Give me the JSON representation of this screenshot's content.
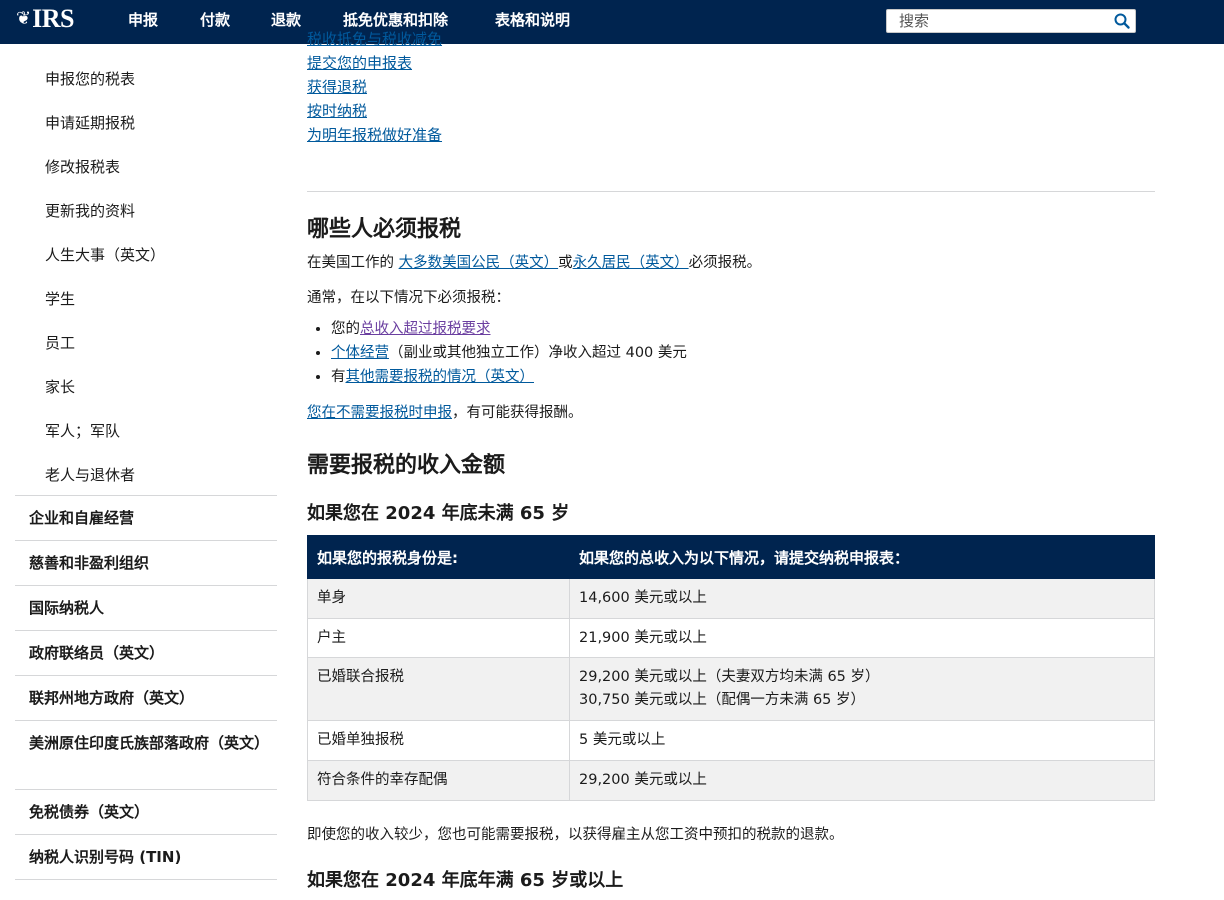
{
  "header": {
    "logo_text": "IRS",
    "nav": [
      "申报",
      "付款",
      "退款",
      "抵免优惠和扣除",
      "表格和说明"
    ],
    "search_placeholder": "搜索"
  },
  "sidebar": {
    "sub_items": [
      "申报您的税表",
      "申请延期报税",
      "修改报税表",
      "更新我的资料",
      "人生大事（英文）",
      "学生",
      "员工",
      "家长",
      "军人；军队",
      "老人与退休者"
    ],
    "main_items": [
      "企业和自雇经营",
      "慈善和非盈利组织",
      "国际纳税人",
      "政府联络员（英文）",
      "联邦州地方政府（英文）",
      "美洲原住印度氏族部落政府（英文）",
      "免税债券（英文）",
      "纳税人识别号码 (TIN)"
    ]
  },
  "main": {
    "top_links": [
      "税收抵免与税收减免",
      "提交您的申报表",
      "获得退税",
      "按时纳税",
      "为明年报税做好准备"
    ],
    "who_must_file": {
      "heading": "哪些人必须报税",
      "intro_prefix": "在美国工作的 ",
      "intro_link1": "大多数美国公民（英文）",
      "intro_mid": "或",
      "intro_link2": "永久居民（英文）",
      "intro_suffix": "必须报税。",
      "generally": "通常，在以下情况下必须报税：",
      "bullets": [
        {
          "prefix": "您的",
          "link": "总收入超过报税要求",
          "suffix": ""
        },
        {
          "prefix": "",
          "link": "个体经营",
          "suffix": "（副业或其他独立工作）净收入超过 400 美元"
        },
        {
          "prefix": "有",
          "link": "其他需要报税的情况（英文）",
          "suffix": ""
        }
      ],
      "file_link": "您在不需要报税时申报",
      "file_suffix": "，有可能获得报酬。"
    },
    "income_heading": "需要报税的收入金额",
    "under65_heading": "如果您在 2024 年底未满 65 岁",
    "table": {
      "headers": [
        "如果您的报税身份是:",
        "如果您的总收入为以下情况，请提交纳税申报表："
      ],
      "rows": [
        {
          "status": "单身",
          "lines": [
            "14,600 美元或以上"
          ]
        },
        {
          "status": "户主",
          "lines": [
            "21,900 美元或以上"
          ]
        },
        {
          "status": "已婚联合报税",
          "lines": [
            "29,200 美元或以上（夫妻双方均未满 65 岁）",
            "30,750 美元或以上（配偶一方未满 65 岁）"
          ]
        },
        {
          "status": "已婚单独报税",
          "lines": [
            "5 美元或以上"
          ]
        },
        {
          "status": "符合条件的幸存配偶",
          "lines": [
            "29,200 美元或以上"
          ]
        }
      ]
    },
    "note": "即使您的收入较少，您也可能需要报税，以获得雇主从您工资中预扣的税款的退款。",
    "over65_heading": "如果您在 2024 年底年满 65 岁或以上"
  }
}
